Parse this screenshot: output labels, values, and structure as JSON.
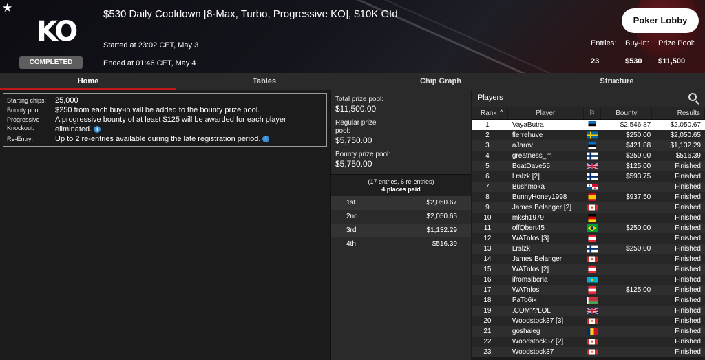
{
  "header": {
    "star_icon": "★",
    "logo": "KO",
    "status_badge": "COMPLETED",
    "title": "$530 Daily Cooldown [8-Max, Turbo, Progressive KO], $10K Gtd",
    "started": "Started at 23:02 CET, May 3",
    "ended": "Ended at 01:46 CET, May 4",
    "lobby_button": "Poker Lobby",
    "entries_label": "Entries:",
    "entries_value": "23",
    "buyin_label": "Buy-In:",
    "buyin_value": "$530",
    "prizepool_label": "Prize Pool:",
    "prizepool_value": "$11,500"
  },
  "tabs": [
    "Home",
    "Tables",
    "Chip Graph",
    "Structure"
  ],
  "info": {
    "starting_chips_label": "Starting chips:",
    "starting_chips": "25,000",
    "bounty_pool_label": "Bounty pool:",
    "bounty_pool": "$250 from each buy-in will be added to the bounty prize pool.",
    "pko_label": "Progressive Knockout:",
    "pko": "A progressive bounty of at least $125 will be awarded for each player eliminated.",
    "reentry_label": "Re-Entry:",
    "reentry": "Up to 2 re-entries available during the late registration period."
  },
  "prize": {
    "total_label": "Total prize pool:",
    "total": "$11,500.00",
    "regular_label": "Regular prize pool:",
    "regular": "$5,750.00",
    "bounty_label": "Bounty prize pool:",
    "bounty": "$5,750.00",
    "entries_note": "(17 entries, 6 re-entries)",
    "places_paid": "4 places paid",
    "paid": [
      {
        "place": "1st",
        "amount": "$2,050.67"
      },
      {
        "place": "2nd",
        "amount": "$2,050.65"
      },
      {
        "place": "3rd",
        "amount": "$1,132.29"
      },
      {
        "place": "4th",
        "amount": "$516.39"
      }
    ]
  },
  "players": {
    "title": "Players",
    "col_rank": "Rank",
    "col_player": "Player",
    "col_bounty": "Bounty",
    "col_results": "Results",
    "rows": [
      {
        "rank": "1",
        "name": "VayaButra",
        "flag": "estonia",
        "bounty": "$2,546.87",
        "result": "$2,050.67"
      },
      {
        "rank": "2",
        "name": "flerrehuve",
        "flag": "sweden",
        "bounty": "$250.00",
        "result": "$2,050.65"
      },
      {
        "rank": "3",
        "name": "aJarov",
        "flag": "estonia",
        "bounty": "$421.88",
        "result": "$1,132.29"
      },
      {
        "rank": "4",
        "name": "greatness_m",
        "flag": "finland",
        "bounty": "$250.00",
        "result": "$516.39"
      },
      {
        "rank": "5",
        "name": "BoatDave55",
        "flag": "uk",
        "bounty": "$125.00",
        "result": "Finished"
      },
      {
        "rank": "6",
        "name": "Lrslzk [2]",
        "flag": "finland",
        "bounty": "$593.75",
        "result": "Finished"
      },
      {
        "rank": "7",
        "name": "Bushmoka",
        "flag": "panama",
        "bounty": "",
        "result": "Finished"
      },
      {
        "rank": "8",
        "name": "BunnyHoney1998",
        "flag": "spain",
        "bounty": "$937.50",
        "result": "Finished"
      },
      {
        "rank": "9",
        "name": "James Belanger [2]",
        "flag": "canada",
        "bounty": "",
        "result": "Finished"
      },
      {
        "rank": "10",
        "name": "mksh1979",
        "flag": "germany",
        "bounty": "",
        "result": "Finished"
      },
      {
        "rank": "11",
        "name": "offQbert45",
        "flag": "brazil",
        "bounty": "$250.00",
        "result": "Finished"
      },
      {
        "rank": "12",
        "name": "WATnlos [3]",
        "flag": "austria",
        "bounty": "",
        "result": "Finished"
      },
      {
        "rank": "13",
        "name": "Lrslzk",
        "flag": "finland",
        "bounty": "$250.00",
        "result": "Finished"
      },
      {
        "rank": "14",
        "name": "James Belanger",
        "flag": "canada",
        "bounty": "",
        "result": "Finished"
      },
      {
        "rank": "15",
        "name": "WATnlos [2]",
        "flag": "austria",
        "bounty": "",
        "result": "Finished"
      },
      {
        "rank": "16",
        "name": "ifromsiberia",
        "flag": "kazakhstan",
        "bounty": "",
        "result": "Finished"
      },
      {
        "rank": "17",
        "name": "WATnlos",
        "flag": "austria",
        "bounty": "$125.00",
        "result": "Finished"
      },
      {
        "rank": "18",
        "name": "PaTo6ik",
        "flag": "belarus",
        "bounty": "",
        "result": "Finished"
      },
      {
        "rank": "19",
        "name": ".COM??LOL",
        "flag": "uk",
        "bounty": "",
        "result": "Finished"
      },
      {
        "rank": "20",
        "name": "Woodstock37 [3]",
        "flag": "canada",
        "bounty": "",
        "result": "Finished"
      },
      {
        "rank": "21",
        "name": "goshaleg",
        "flag": "romania",
        "bounty": "",
        "result": "Finished"
      },
      {
        "rank": "22",
        "name": "Woodstock37 [2]",
        "flag": "canada",
        "bounty": "",
        "result": "Finished"
      },
      {
        "rank": "23",
        "name": "Woodstock37",
        "flag": "canada",
        "bounty": "",
        "result": "Finished"
      }
    ]
  },
  "colors": {
    "accent": "#c0161c",
    "info_icon": "#3c8fd4"
  }
}
